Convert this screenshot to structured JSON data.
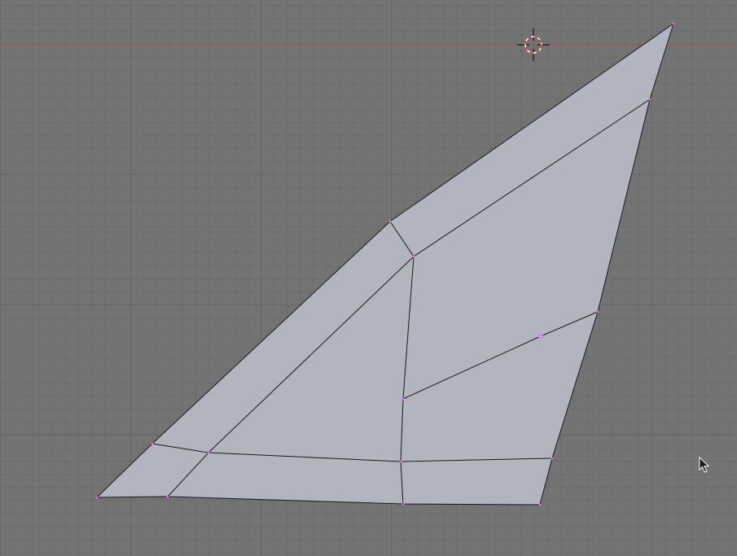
{
  "viewport": {
    "background_color": "#737373",
    "grid_minor_color": "#6d6d6d",
    "grid_major_color": "#666666",
    "x_axis_color": "#b84c4c"
  },
  "mesh": {
    "face_color": "#b2b5bf",
    "edge_color": "#1a1a1a",
    "vertex_color": "#ff66ff",
    "selected": false
  },
  "icons": {
    "cursor_3d": "3d-cursor-icon",
    "mouse_pointer": "mouse-pointer-icon"
  }
}
